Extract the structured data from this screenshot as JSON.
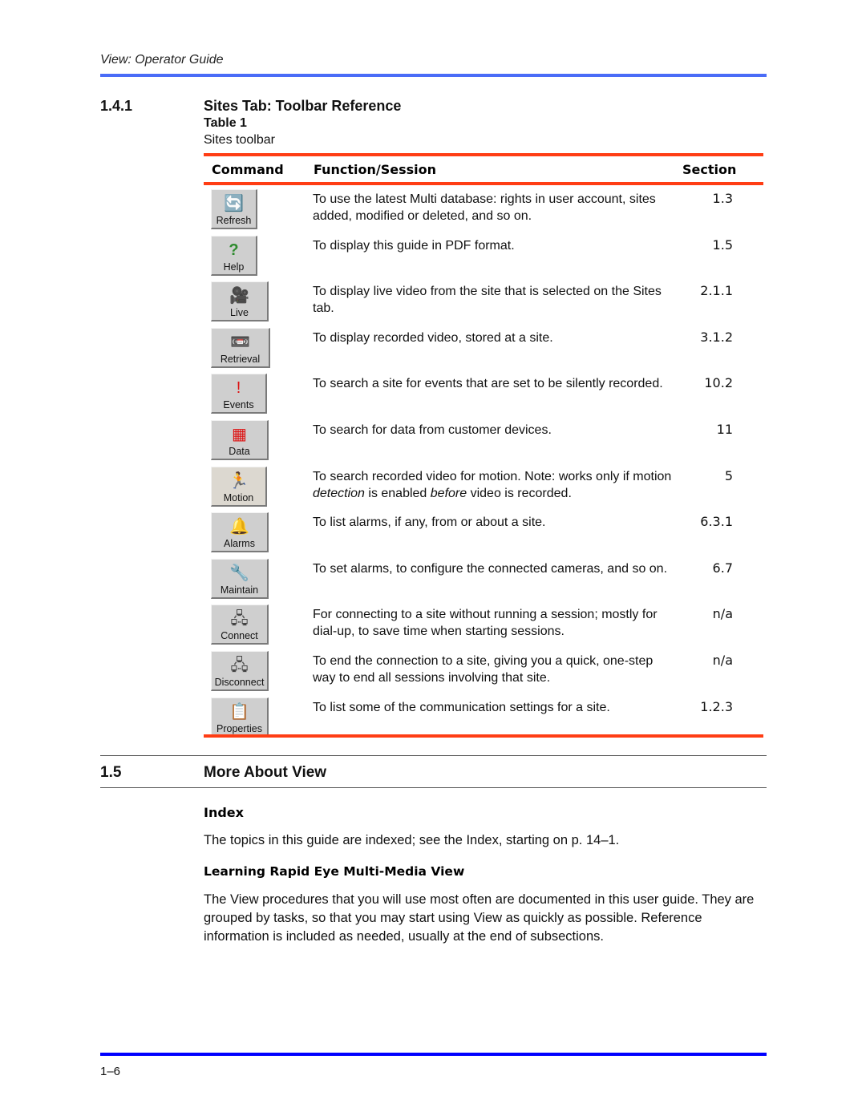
{
  "header": {
    "running_title": "View: Operator Guide"
  },
  "section_141": {
    "number": "1.4.1",
    "title": "Sites Tab: Toolbar Reference",
    "table_label": "Table 1",
    "table_caption": "Sites toolbar",
    "columns": [
      "Command",
      "Function/Session",
      "Section"
    ],
    "rows": [
      {
        "command": "Refresh",
        "icon": "database-refresh-icon",
        "glyph": "🔄",
        "function": "To use the latest Multi database: rights in user account, sites added, modified or deleted, and so on.",
        "section": "1.3"
      },
      {
        "command": "Help",
        "icon": "question-mark-icon",
        "glyph": "?",
        "function": "To display this guide in PDF format.",
        "section": "1.5"
      },
      {
        "command": "Live",
        "icon": "video-camera-icon",
        "glyph": "🎥",
        "function": "To display live video from the site that is selected on the Sites tab.",
        "section": "2.1.1"
      },
      {
        "command": "Retrieval",
        "icon": "camera-retrieval-icon",
        "glyph": "📼",
        "function": "To display recorded video, stored at a site.",
        "section": "3.1.2"
      },
      {
        "command": "Events",
        "icon": "event-exclamation-icon",
        "glyph": "!",
        "function": "To search a site for events that are set to be silently recorded.",
        "section": "10.2"
      },
      {
        "command": "Data",
        "icon": "data-grid-icon",
        "glyph": "▦",
        "function": "To search for data from customer devices.",
        "section": "11"
      },
      {
        "command": "Motion",
        "icon": "running-person-icon",
        "glyph": "🏃",
        "function_html": "To search recorded video for motion. Note: works only if motion <i>detection</i> is enabled <i>before</i> video is recorded.",
        "function": "To search recorded video for motion. Note: works only if motion detection is enabled before video is recorded.",
        "section": "5"
      },
      {
        "command": "Alarms",
        "icon": "alarm-bell-icon",
        "glyph": "🔔",
        "function": "To list alarms, if any, from or about a site.",
        "section": "6.3.1"
      },
      {
        "command": "Maintain",
        "icon": "wrench-screwdriver-icon",
        "glyph": "🔧",
        "function": "To set alarms, to configure the connected cameras, and so on.",
        "section": "6.7"
      },
      {
        "command": "Connect",
        "icon": "connect-modem-icon",
        "glyph": "🖧",
        "function": "For connecting to a site without running a session; mostly for dial-up, to save time when starting sessions.",
        "section": "n/a"
      },
      {
        "command": "Disconnect",
        "icon": "disconnect-modem-icon",
        "glyph": "🖧",
        "function": "To end the connection to a site, giving you a quick, one-step way to end all sessions involving that site.",
        "section": "n/a"
      },
      {
        "command": "Properties",
        "icon": "properties-sheet-icon",
        "glyph": "📋",
        "function": "To list some of the communication settings for a site.",
        "section": "1.2.3"
      }
    ]
  },
  "section_15": {
    "number": "1.5",
    "title": "More About View",
    "index_heading": "Index",
    "index_text": "The topics in this guide are indexed; see the Index, starting on p. 14–1.",
    "learning_heading": "Learning Rapid Eye Multi-Media View",
    "learning_text": "The View procedures that you will use most often are documented in this user guide. They are grouped by tasks, so that you may start using View as quickly as possible. Reference information is included as needed, usually at the end of subsections."
  },
  "footer": {
    "page_number": "1–6"
  },
  "colors": {
    "top_rule": "#4a6cf7",
    "table_rule": "#ff3d14",
    "bottom_rule": "#0000ff"
  }
}
